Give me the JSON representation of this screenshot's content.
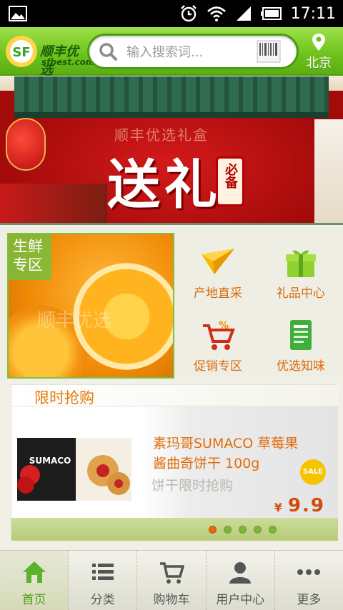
{
  "status_bar": {
    "time": "17:11"
  },
  "header": {
    "logo_cn": "顺丰优选",
    "logo_en": "sfbest.com",
    "search_placeholder": "输入搜索词...",
    "location": "北京"
  },
  "banner": {
    "watermark": "顺丰优选礼盒",
    "title": "送礼",
    "seal_text": "必备"
  },
  "categories": {
    "fresh_label": "生鲜专区",
    "fresh_watermark": "顺丰优选",
    "items": [
      {
        "label": "产地直采",
        "icon": "paper-plane-icon"
      },
      {
        "label": "礼品中心",
        "icon": "gift-icon"
      },
      {
        "label": "促销专区",
        "icon": "discount-cart-icon"
      },
      {
        "label": "优选知味",
        "icon": "document-icon"
      }
    ]
  },
  "flash_sale": {
    "heading": "限时抢购",
    "product_title": "素玛哥SUMACO 草莓果酱曲奇饼干 100g",
    "product_subtitle": "饼干限时抢购",
    "badge": "SALE",
    "currency": "¥",
    "price": "9.9",
    "brand_on_box": "SUMACO",
    "active_dot": 0,
    "dot_count": 5
  },
  "tabbar": {
    "tabs": [
      {
        "label": "首页",
        "icon": "home-icon",
        "active": true
      },
      {
        "label": "分类",
        "icon": "list-icon",
        "active": false
      },
      {
        "label": "购物车",
        "icon": "cart-icon",
        "active": false
      },
      {
        "label": "用户中心",
        "icon": "user-icon",
        "active": false
      },
      {
        "label": "更多",
        "icon": "more-icon",
        "active": false
      }
    ]
  },
  "colors": {
    "header_green": "#6cc21a",
    "accent_orange": "#e06f0f",
    "tab_active": "#4f9f1a"
  }
}
